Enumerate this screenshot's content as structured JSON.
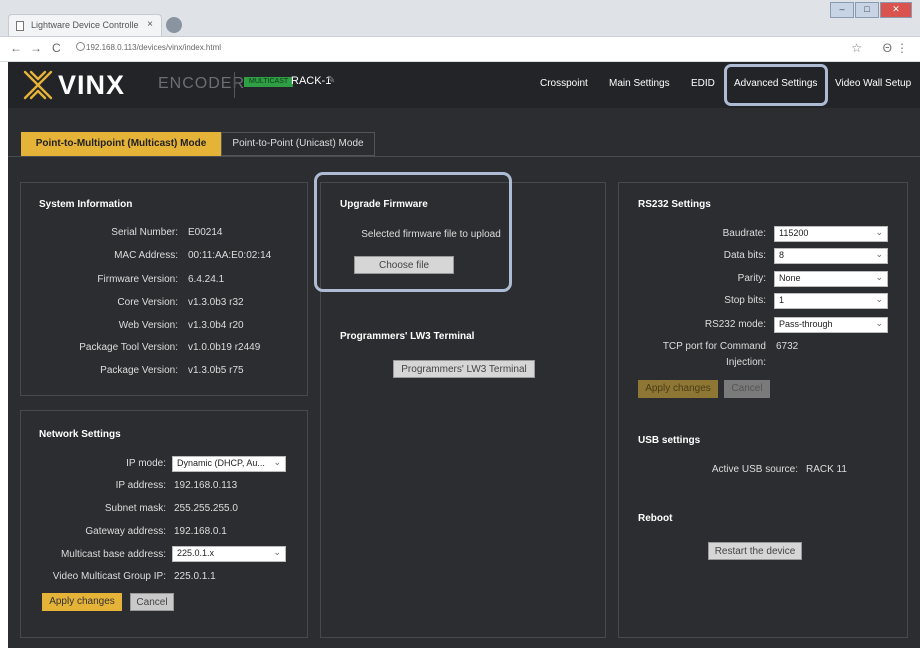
{
  "browser": {
    "tab_title": "Lightware Device Controlle",
    "tab_close": "×",
    "url": "192.168.0.113/devices/vinx/index.html",
    "window_controls": [
      "–",
      "□",
      "✕"
    ],
    "nav": {
      "back": "←",
      "forward": "→",
      "reload": "C"
    },
    "star": "☆",
    "account": "Θ",
    "menu": "⋮"
  },
  "header": {
    "logo": "VINX",
    "device_type": "ENCODER",
    "status_badge": "MULTICAST",
    "device_name": "RACK-1",
    "edit_icon": "✎",
    "nav": {
      "crosspoint": "Crosspoint",
      "main_settings": "Main Settings",
      "edid": "EDID",
      "advanced_settings": "Advanced Settings",
      "video_wall_setup": "Video Wall Setup"
    }
  },
  "modes": {
    "multicast": "Point-to-Multipoint (Multicast) Mode",
    "unicast": "Point-to-Point (Unicast) Mode"
  },
  "system_info": {
    "title": "System Information",
    "rows": [
      {
        "label": "Serial Number:",
        "value": "E00214"
      },
      {
        "label": "MAC Address:",
        "value": "00:11:AA:E0:02:14"
      },
      {
        "label": "Firmware Version:",
        "value": "6.4.24.1"
      },
      {
        "label": "Core Version:",
        "value": "v1.3.0b3 r32"
      },
      {
        "label": "Web Version:",
        "value": "v1.3.0b4 r20"
      },
      {
        "label": "Package Tool Version:",
        "value": "v1.0.0b19 r2449"
      },
      {
        "label": "Package Version:",
        "value": "v1.3.0b5 r75"
      }
    ]
  },
  "network": {
    "title": "Network Settings",
    "ip_mode_label": "IP mode:",
    "ip_mode_value": "Dynamic (DHCP, Au...",
    "ip_address_label": "IP address:",
    "ip_address_value": "192.168.0.113",
    "subnet_label": "Subnet mask:",
    "subnet_value": "255.255.255.0",
    "gateway_label": "Gateway address:",
    "gateway_value": "192.168.0.1",
    "multicast_base_label": "Multicast base address:",
    "multicast_base_value": "225.0.1.x",
    "video_group_label": "Video Multicast Group IP:",
    "video_group_value": "225.0.1.1",
    "apply": "Apply changes",
    "cancel": "Cancel"
  },
  "firmware": {
    "title": "Upgrade Firmware",
    "text": "Selected firmware file to upload",
    "choose": "Choose file"
  },
  "terminal": {
    "title": "Programmers' LW3 Terminal",
    "button": "Programmers' LW3 Terminal"
  },
  "rs232": {
    "title": "RS232 Settings",
    "baudrate_label": "Baudrate:",
    "baudrate_value": "115200",
    "databits_label": "Data bits:",
    "databits_value": "8",
    "parity_label": "Parity:",
    "parity_value": "None",
    "stopbits_label": "Stop bits:",
    "stopbits_value": "1",
    "mode_label": "RS232 mode:",
    "mode_value": "Pass-through",
    "tcp_label_1": "TCP port for Command",
    "tcp_label_2": "Injection:",
    "tcp_value": "6732",
    "apply": "Apply changes",
    "cancel": "Cancel"
  },
  "usb": {
    "title": "USB settings",
    "label": "Active USB source:",
    "value": "RACK 11"
  },
  "reboot": {
    "title": "Reboot",
    "button": "Restart the device"
  },
  "colors": {
    "accent": "#e6b339",
    "background": "#2b2d30",
    "highlight": "#aebbd4"
  }
}
